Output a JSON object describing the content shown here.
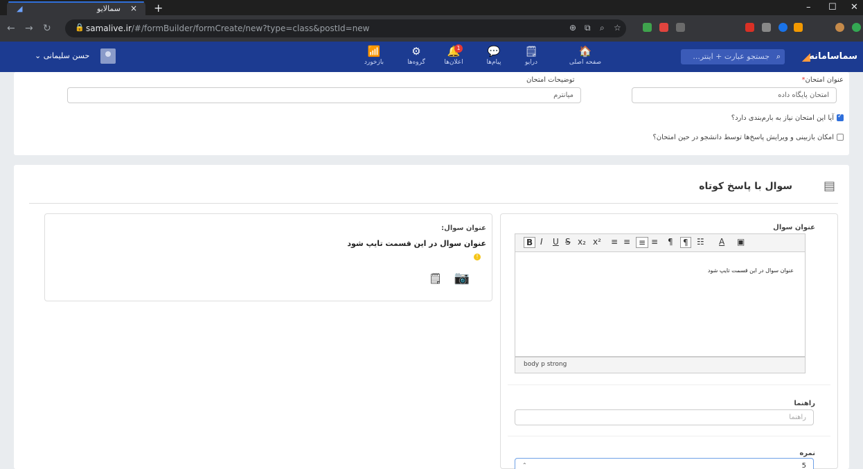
{
  "browser": {
    "tab_title": "سمالایو",
    "tab_close": "×",
    "new_tab": "+",
    "url_host": "samalive.ir",
    "url_path": "/#/formBuilder/formCreate/new?type=class&postId=new",
    "window_controls": [
      "–",
      "☐",
      "✕"
    ]
  },
  "navbar": {
    "brand": "سماسامانه",
    "search_placeholder": "جستجو عبارت + اینتر...",
    "items": [
      {
        "label": "صفحه اصلی",
        "icon": "home-icon",
        "glyph": "🏠"
      },
      {
        "label": "درایو",
        "icon": "drive-icon",
        "glyph": "🗒"
      },
      {
        "label": "پیام‌ها",
        "icon": "chat-icon",
        "glyph": "💬"
      },
      {
        "label": "اعلان‌ها",
        "icon": "bell-icon",
        "glyph": "🔔",
        "badge": "1"
      },
      {
        "label": "گروه‌ها",
        "icon": "groups-icon",
        "glyph": "⚙"
      },
      {
        "label": "بازخورد",
        "icon": "feed-icon",
        "glyph": "📶"
      }
    ],
    "user_name": "حسن سلیمانی",
    "user_caret": "⌄"
  },
  "exam": {
    "title_label": "عنوان امتحان",
    "required_mark": "*",
    "title_value": "امتحان پایگاه داده",
    "description_label": "توضیحات امتحان",
    "description_value": "میانترم",
    "checkbox_grading": "آیا این امتحان نیاز به بارم‌بندی دارد؟",
    "checkbox_grading_checked": true,
    "checkbox_review": "امکان بازبینی و ویرایش پاسخ‌ها توسط دانشجو در حین امتحان؟",
    "checkbox_review_checked": false
  },
  "question": {
    "header": "سوال با پاسخ کوتاه",
    "title_label": "عنوان سوال",
    "toolbar": [
      "B",
      "I",
      "U",
      "S",
      "x₂",
      "x²",
      "≡",
      "≡",
      "≡",
      "≡",
      "¶",
      "¶",
      "☷",
      "A",
      "▣"
    ],
    "editor_text": "عنوان سوال در این قسمت تایپ شود",
    "path_items": "body  p  strong",
    "hint_label": "راهنما",
    "hint_placeholder": "راهنما",
    "score_label": "نمره",
    "score_value": "5"
  },
  "preview": {
    "label": "عنوان سوال:",
    "text": "عنوان سوال در این قسمت تایپ شود",
    "info_glyph": "!",
    "camera_glyph": "📷",
    "note_glyph": "🗒"
  }
}
